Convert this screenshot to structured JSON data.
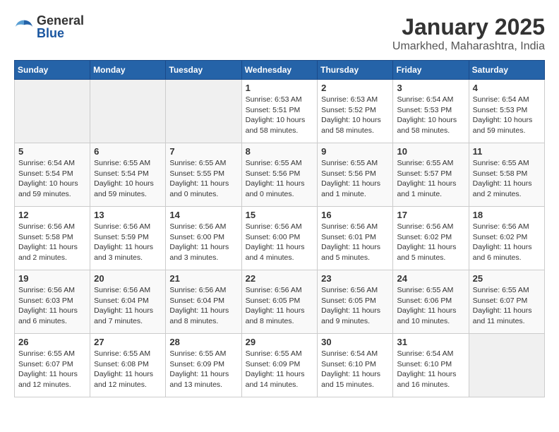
{
  "header": {
    "logo_general": "General",
    "logo_blue": "Blue",
    "title": "January 2025",
    "subtitle": "Umarkhed, Maharashtra, India"
  },
  "days_of_week": [
    "Sunday",
    "Monday",
    "Tuesday",
    "Wednesday",
    "Thursday",
    "Friday",
    "Saturday"
  ],
  "weeks": [
    [
      {
        "day": "",
        "info": ""
      },
      {
        "day": "",
        "info": ""
      },
      {
        "day": "",
        "info": ""
      },
      {
        "day": "1",
        "info": "Sunrise: 6:53 AM\nSunset: 5:51 PM\nDaylight: 10 hours and 58 minutes."
      },
      {
        "day": "2",
        "info": "Sunrise: 6:53 AM\nSunset: 5:52 PM\nDaylight: 10 hours and 58 minutes."
      },
      {
        "day": "3",
        "info": "Sunrise: 6:54 AM\nSunset: 5:53 PM\nDaylight: 10 hours and 58 minutes."
      },
      {
        "day": "4",
        "info": "Sunrise: 6:54 AM\nSunset: 5:53 PM\nDaylight: 10 hours and 59 minutes."
      }
    ],
    [
      {
        "day": "5",
        "info": "Sunrise: 6:54 AM\nSunset: 5:54 PM\nDaylight: 10 hours and 59 minutes."
      },
      {
        "day": "6",
        "info": "Sunrise: 6:55 AM\nSunset: 5:54 PM\nDaylight: 10 hours and 59 minutes."
      },
      {
        "day": "7",
        "info": "Sunrise: 6:55 AM\nSunset: 5:55 PM\nDaylight: 11 hours and 0 minutes."
      },
      {
        "day": "8",
        "info": "Sunrise: 6:55 AM\nSunset: 5:56 PM\nDaylight: 11 hours and 0 minutes."
      },
      {
        "day": "9",
        "info": "Sunrise: 6:55 AM\nSunset: 5:56 PM\nDaylight: 11 hours and 1 minute."
      },
      {
        "day": "10",
        "info": "Sunrise: 6:55 AM\nSunset: 5:57 PM\nDaylight: 11 hours and 1 minute."
      },
      {
        "day": "11",
        "info": "Sunrise: 6:55 AM\nSunset: 5:58 PM\nDaylight: 11 hours and 2 minutes."
      }
    ],
    [
      {
        "day": "12",
        "info": "Sunrise: 6:56 AM\nSunset: 5:58 PM\nDaylight: 11 hours and 2 minutes."
      },
      {
        "day": "13",
        "info": "Sunrise: 6:56 AM\nSunset: 5:59 PM\nDaylight: 11 hours and 3 minutes."
      },
      {
        "day": "14",
        "info": "Sunrise: 6:56 AM\nSunset: 6:00 PM\nDaylight: 11 hours and 3 minutes."
      },
      {
        "day": "15",
        "info": "Sunrise: 6:56 AM\nSunset: 6:00 PM\nDaylight: 11 hours and 4 minutes."
      },
      {
        "day": "16",
        "info": "Sunrise: 6:56 AM\nSunset: 6:01 PM\nDaylight: 11 hours and 5 minutes."
      },
      {
        "day": "17",
        "info": "Sunrise: 6:56 AM\nSunset: 6:02 PM\nDaylight: 11 hours and 5 minutes."
      },
      {
        "day": "18",
        "info": "Sunrise: 6:56 AM\nSunset: 6:02 PM\nDaylight: 11 hours and 6 minutes."
      }
    ],
    [
      {
        "day": "19",
        "info": "Sunrise: 6:56 AM\nSunset: 6:03 PM\nDaylight: 11 hours and 6 minutes."
      },
      {
        "day": "20",
        "info": "Sunrise: 6:56 AM\nSunset: 6:04 PM\nDaylight: 11 hours and 7 minutes."
      },
      {
        "day": "21",
        "info": "Sunrise: 6:56 AM\nSunset: 6:04 PM\nDaylight: 11 hours and 8 minutes."
      },
      {
        "day": "22",
        "info": "Sunrise: 6:56 AM\nSunset: 6:05 PM\nDaylight: 11 hours and 8 minutes."
      },
      {
        "day": "23",
        "info": "Sunrise: 6:56 AM\nSunset: 6:05 PM\nDaylight: 11 hours and 9 minutes."
      },
      {
        "day": "24",
        "info": "Sunrise: 6:55 AM\nSunset: 6:06 PM\nDaylight: 11 hours and 10 minutes."
      },
      {
        "day": "25",
        "info": "Sunrise: 6:55 AM\nSunset: 6:07 PM\nDaylight: 11 hours and 11 minutes."
      }
    ],
    [
      {
        "day": "26",
        "info": "Sunrise: 6:55 AM\nSunset: 6:07 PM\nDaylight: 11 hours and 12 minutes."
      },
      {
        "day": "27",
        "info": "Sunrise: 6:55 AM\nSunset: 6:08 PM\nDaylight: 11 hours and 12 minutes."
      },
      {
        "day": "28",
        "info": "Sunrise: 6:55 AM\nSunset: 6:09 PM\nDaylight: 11 hours and 13 minutes."
      },
      {
        "day": "29",
        "info": "Sunrise: 6:55 AM\nSunset: 6:09 PM\nDaylight: 11 hours and 14 minutes."
      },
      {
        "day": "30",
        "info": "Sunrise: 6:54 AM\nSunset: 6:10 PM\nDaylight: 11 hours and 15 minutes."
      },
      {
        "day": "31",
        "info": "Sunrise: 6:54 AM\nSunset: 6:10 PM\nDaylight: 11 hours and 16 minutes."
      },
      {
        "day": "",
        "info": ""
      }
    ]
  ]
}
